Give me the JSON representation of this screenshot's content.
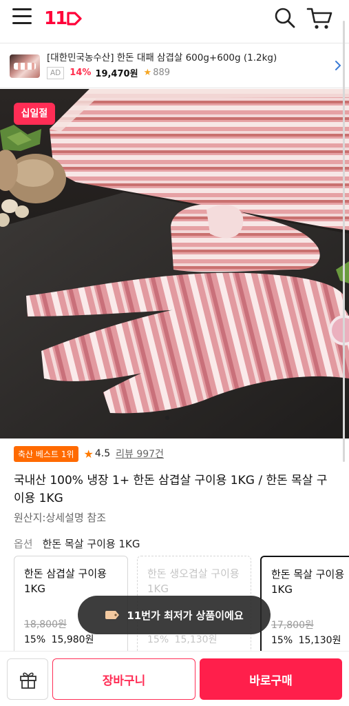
{
  "header": {
    "logo_text": "11",
    "brand_color": "#ff0038"
  },
  "ad": {
    "title": "[대한민국농수산] 한돈 대패 삼겹살 600g+600g (1.2kg)",
    "badge": "AD",
    "discount": "14%",
    "price": "19,470원",
    "rating_count": "889"
  },
  "hero": {
    "badge": "십일절",
    "badge_color": "#ff2d55"
  },
  "product": {
    "best_tag": "축산 베스트 1위",
    "rating": "4.5",
    "review_label": "리뷰 997건",
    "title": "국내산 100% 냉장 1+ 한돈 삼겹살 구이용 1KG / 한돈 목살 구이용 1KG",
    "origin": "원산지:상세설명 참조"
  },
  "option": {
    "label": "옵션",
    "selected_value": "한돈 목살 구이용 1KG",
    "cards": [
      {
        "name": "한돈 삼겹살 구이용 1KG",
        "original_price": "18,800원",
        "discount": "15%",
        "price": "15,980원",
        "state": "normal"
      },
      {
        "name": "한돈 생오겹살 구이용 1KG",
        "original_price": "",
        "discount": "15%",
        "price": "15,130원",
        "state": "disabled"
      },
      {
        "name": "한돈 목살 구이용 1KG",
        "original_price": "17,800원",
        "discount": "15%",
        "price": "15,130원",
        "state": "selected"
      }
    ]
  },
  "toast": {
    "text": "11번가 최저가 상품이에요"
  },
  "bottom_bar": {
    "cart_label": "장바구니",
    "buy_label": "바로구매",
    "accent_color": "#ff1f4b"
  }
}
